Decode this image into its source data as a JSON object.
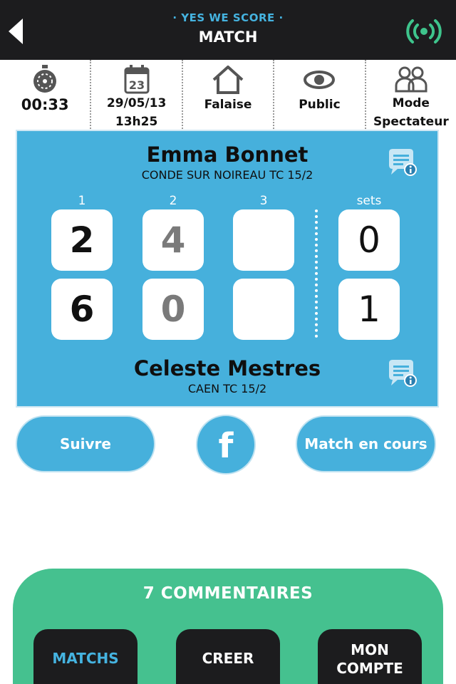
{
  "header": {
    "brand": "· YES WE SCORE ·",
    "title": "MATCH",
    "live_color": "#3ec48c"
  },
  "info": {
    "timer": "00:33",
    "date": "29/05/13",
    "time": "13h25",
    "calendar_day": "23",
    "venue": "Falaise",
    "visibility": "Public",
    "mode_line1": "Mode",
    "mode_line2": "Spectateur"
  },
  "match": {
    "set_labels": [
      "1",
      "2",
      "3"
    ],
    "sets_label": "sets",
    "player1": {
      "name": "Emma Bonnet",
      "club": "CONDE SUR NOIREAU TC 15/2",
      "games": [
        "2",
        "4",
        ""
      ],
      "sets": "0"
    },
    "player2": {
      "name": "Celeste Mestres",
      "club": "CAEN TC 15/2",
      "games": [
        "6",
        "0",
        ""
      ],
      "sets": "1"
    }
  },
  "actions": {
    "follow_label": "Suivre",
    "facebook_glyph": "f",
    "status_label": "Match en cours"
  },
  "bottom": {
    "comments_label": "7 COMMENTAIRES",
    "tabs": [
      {
        "label_line1": "MATCHS",
        "label_line2": "",
        "active": true
      },
      {
        "label_line1": "CREER",
        "label_line2": "",
        "active": false
      },
      {
        "label_line1": "MON",
        "label_line2": "COMPTE",
        "active": false
      }
    ]
  },
  "colors": {
    "topbar": "#1c1c1e",
    "accent_blue": "#46b0dc",
    "accent_green": "#45c18f"
  }
}
